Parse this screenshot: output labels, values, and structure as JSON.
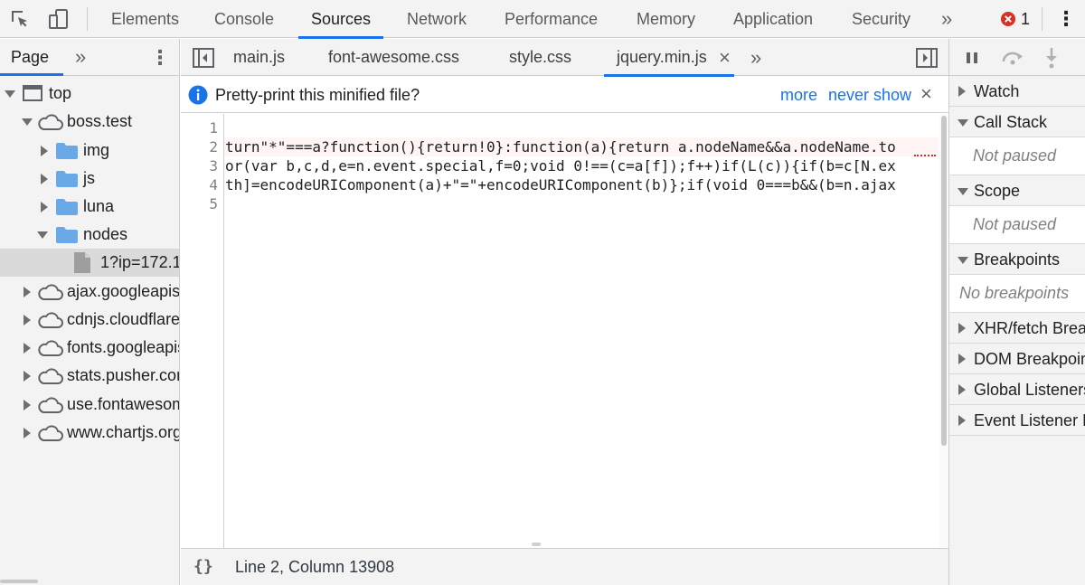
{
  "toolbar": {
    "tabs": [
      "Elements",
      "Console",
      "Sources",
      "Network",
      "Performance",
      "Memory",
      "Application",
      "Security"
    ],
    "more": "»",
    "error_count": "1",
    "menu": "⋮"
  },
  "navigator": {
    "tab_label": "Page",
    "more": "»",
    "menu": "⋮",
    "tree": [
      {
        "label": "top",
        "kind": "frame"
      },
      {
        "label": "boss.test",
        "kind": "domain"
      },
      {
        "label": "img",
        "kind": "folder"
      },
      {
        "label": "js",
        "kind": "folder"
      },
      {
        "label": "luna",
        "kind": "folder"
      },
      {
        "label": "nodes",
        "kind": "folder"
      },
      {
        "label": "1?ip=172.1",
        "kind": "file"
      },
      {
        "label": "ajax.googleapis.com",
        "kind": "domain"
      },
      {
        "label": "cdnjs.cloudflare.com",
        "kind": "domain"
      },
      {
        "label": "fonts.googleapis.com",
        "kind": "domain"
      },
      {
        "label": "stats.pusher.com",
        "kind": "domain"
      },
      {
        "label": "use.fontawesome.com",
        "kind": "domain"
      },
      {
        "label": "www.chartjs.org",
        "kind": "domain"
      }
    ]
  },
  "editor": {
    "file_tabs": [
      "main.js",
      "font-awesome.css",
      "style.css",
      "jquery.min.js"
    ],
    "close_tab": "×",
    "more_tabs": "»",
    "infobar": {
      "message": "Pretty-print this minified file?",
      "more": "more",
      "never_show": "never show",
      "close": "×"
    },
    "line_numbers": [
      "1",
      "2",
      "3",
      "4",
      "5"
    ],
    "code_lines": [
      "",
      "turn\"*\"===a?function(){return!0}:function(a){return a.nodeName&&a.nodeName.to",
      "or(var b,c,d,e=n.event.special,f=0;void 0!==(c=a[f]);f++)if(L(c)){if(b=c[N.ex",
      "th]=encodeURIComponent(a)+\"=\"+encodeURIComponent(b)};if(void 0===b&&(b=n.ajax",
      ""
    ],
    "status": {
      "pretty_print": "{}",
      "position": "Line 2, Column 13908"
    }
  },
  "debugger": {
    "sections": {
      "watch": "Watch",
      "call_stack": "Call Stack",
      "call_stack_note": "Not paused",
      "scope": "Scope",
      "scope_note": "Not paused",
      "breakpoints": "Breakpoints",
      "breakpoints_note": "No breakpoints",
      "xhr": "XHR/fetch Breakpoints",
      "dom": "DOM Breakpoints",
      "global": "Global Listeners",
      "event": "Event Listener Breakpoints"
    }
  },
  "colors": {
    "accent": "#1a73e8",
    "error": "#d93025",
    "panel": "#f3f3f3"
  }
}
